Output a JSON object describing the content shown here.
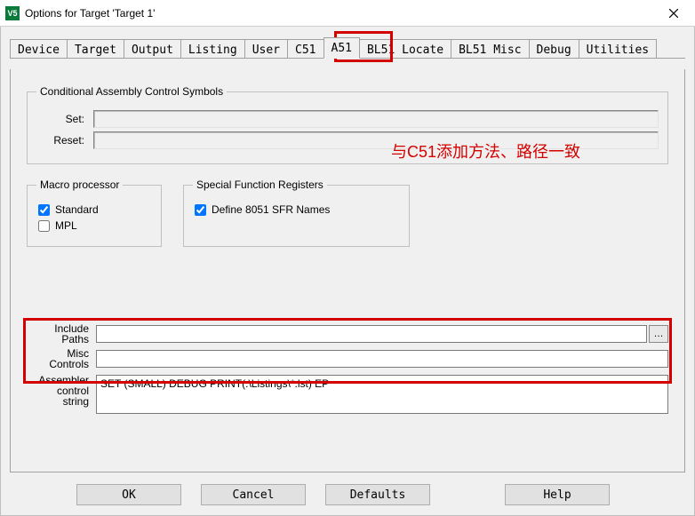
{
  "window": {
    "title": "Options for Target 'Target 1'",
    "icon_text": "V5"
  },
  "tabs": [
    {
      "label": "Device"
    },
    {
      "label": "Target"
    },
    {
      "label": "Output"
    },
    {
      "label": "Listing"
    },
    {
      "label": "User"
    },
    {
      "label": "C51"
    },
    {
      "label": "A51"
    },
    {
      "label": "BL51 Locate"
    },
    {
      "label": "BL51 Misc"
    },
    {
      "label": "Debug"
    },
    {
      "label": "Utilities"
    }
  ],
  "active_tab": "A51",
  "groups": {
    "cond_asm": {
      "legend": "Conditional Assembly Control Symbols",
      "set_label": "Set:",
      "reset_label": "Reset:",
      "set_value": "",
      "reset_value": ""
    },
    "macro": {
      "legend": "Macro processor",
      "standard_label": "Standard",
      "standard_checked": true,
      "mpl_label": "MPL",
      "mpl_checked": false
    },
    "sfr": {
      "legend": "Special Function Registers",
      "define_label": "Define 8051 SFR Names",
      "define_checked": true
    }
  },
  "fields": {
    "include_label": "Include\nPaths",
    "include_value": "",
    "misc_label": "Misc\nControls",
    "misc_value": "",
    "asm_label": "Assembler\ncontrol\nstring",
    "asm_value": "SET (SMALL) DEBUG PRINT(.\\Listings\\*.lst) EP"
  },
  "buttons": {
    "ok": "OK",
    "cancel": "Cancel",
    "defaults": "Defaults",
    "help": "Help"
  },
  "annotation": {
    "text": "与C51添加方法、路径一致"
  }
}
